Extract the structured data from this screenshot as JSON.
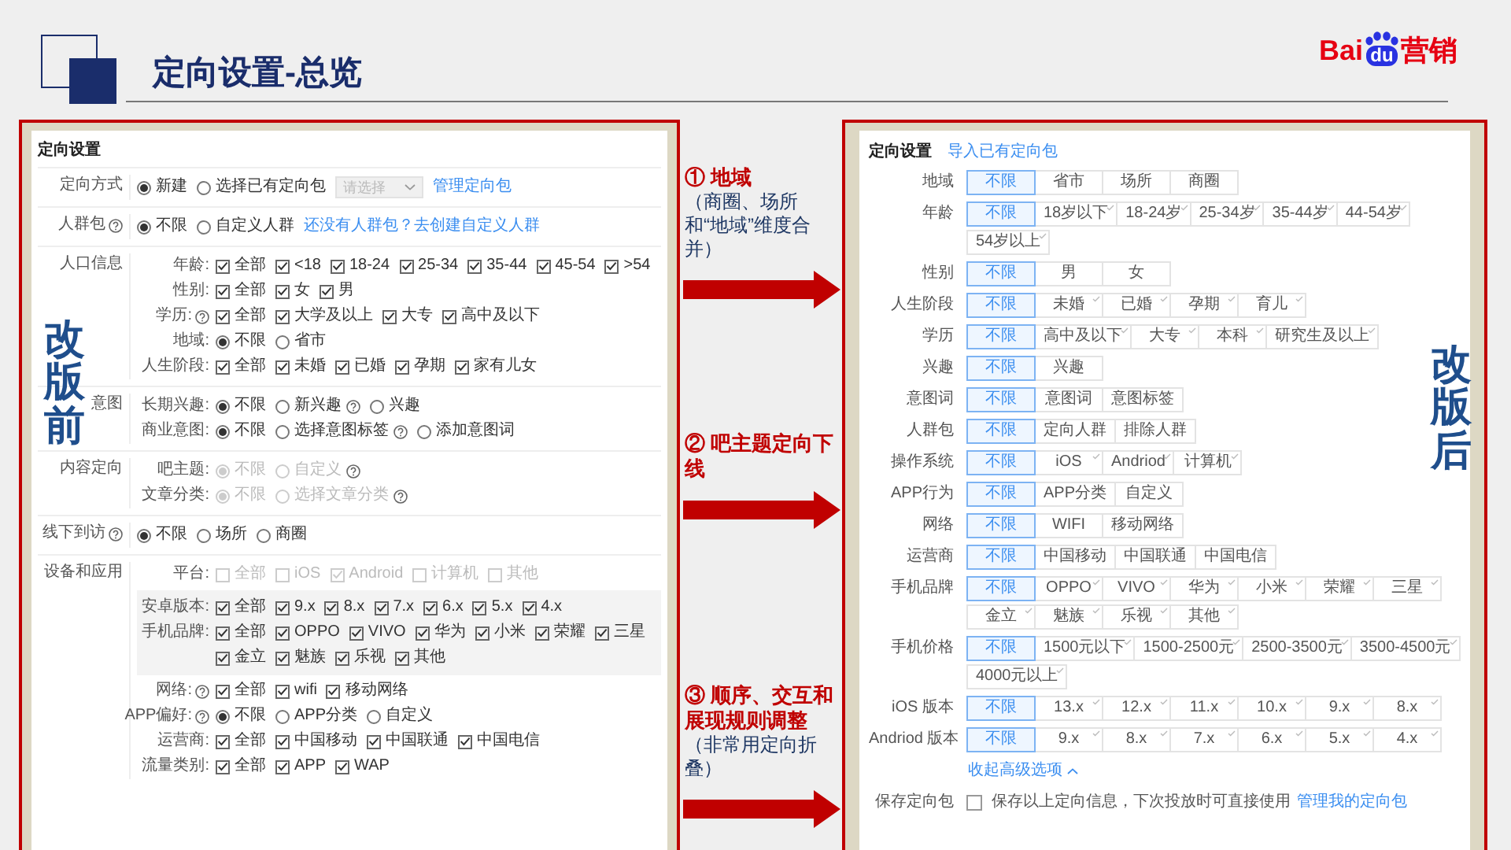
{
  "header": {
    "title": "定向设置-总览",
    "logo": {
      "left": "Bai",
      "mark": "du",
      "right": "营销"
    }
  },
  "before": {
    "badge": "改版前",
    "title": "定向设置",
    "sections": [
      {
        "label": "定向方式",
        "rows": [
          {
            "kind": "row",
            "options": [
              {
                "kind": "radio",
                "label": "新建",
                "checked": true
              },
              {
                "kind": "radio",
                "label": "选择已有定向包",
                "checked": false
              },
              {
                "kind": "select",
                "placeholder": "请选择"
              },
              {
                "kind": "link",
                "label": "管理定向包"
              }
            ]
          }
        ]
      },
      {
        "label": "人群包",
        "help": true,
        "rows": [
          {
            "kind": "row",
            "options": [
              {
                "kind": "radio",
                "label": "不限",
                "checked": true
              },
              {
                "kind": "radio",
                "label": "自定义人群",
                "checked": false
              },
              {
                "kind": "link",
                "label": "还没有人群包？去创建自定义人群"
              }
            ]
          }
        ]
      },
      {
        "label": "人口信息",
        "rows": [
          {
            "kind": "row",
            "label": "年龄:",
            "options": [
              {
                "kind": "checkbox",
                "label": "全部",
                "checked": true
              },
              {
                "kind": "checkbox",
                "label": "<18",
                "checked": true
              },
              {
                "kind": "checkbox",
                "label": "18-24",
                "checked": true
              },
              {
                "kind": "checkbox",
                "label": "25-34",
                "checked": true
              },
              {
                "kind": "checkbox",
                "label": "35-44",
                "checked": true
              },
              {
                "kind": "checkbox",
                "label": "45-54",
                "checked": true
              },
              {
                "kind": "checkbox",
                "label": ">54",
                "checked": true
              }
            ]
          },
          {
            "kind": "row",
            "label": "性别:",
            "options": [
              {
                "kind": "checkbox",
                "label": "全部",
                "checked": true
              },
              {
                "kind": "checkbox",
                "label": "女",
                "checked": true
              },
              {
                "kind": "checkbox",
                "label": "男",
                "checked": true
              }
            ]
          },
          {
            "kind": "row",
            "label": "学历:",
            "help": true,
            "options": [
              {
                "kind": "checkbox",
                "label": "全部",
                "checked": true
              },
              {
                "kind": "checkbox",
                "label": "大学及以上",
                "checked": true
              },
              {
                "kind": "checkbox",
                "label": "大专",
                "checked": true
              },
              {
                "kind": "checkbox",
                "label": "高中及以下",
                "checked": true
              }
            ]
          },
          {
            "kind": "row",
            "label": "地域:",
            "options": [
              {
                "kind": "radio",
                "label": "不限",
                "checked": true
              },
              {
                "kind": "radio",
                "label": "省市",
                "checked": false
              }
            ]
          },
          {
            "kind": "row",
            "label": "人生阶段:",
            "options": [
              {
                "kind": "checkbox",
                "label": "全部",
                "checked": true
              },
              {
                "kind": "checkbox",
                "label": "未婚",
                "checked": true
              },
              {
                "kind": "checkbox",
                "label": "已婚",
                "checked": true
              },
              {
                "kind": "checkbox",
                "label": "孕期",
                "checked": true
              },
              {
                "kind": "checkbox",
                "label": "家有儿女",
                "checked": true
              }
            ]
          }
        ]
      },
      {
        "label": "意图",
        "rows": [
          {
            "kind": "row",
            "label": "长期兴趣:",
            "options": [
              {
                "kind": "radio",
                "label": "不限",
                "checked": true
              },
              {
                "kind": "radio",
                "label": "新兴趣",
                "checked": false,
                "help": true
              },
              {
                "kind": "radio",
                "label": "兴趣",
                "checked": false
              }
            ]
          },
          {
            "kind": "row",
            "label": "商业意图:",
            "options": [
              {
                "kind": "radio",
                "label": "不限",
                "checked": true
              },
              {
                "kind": "radio",
                "label": "选择意图标签",
                "checked": false,
                "help": true
              },
              {
                "kind": "radio",
                "label": "添加意图词",
                "checked": false
              }
            ]
          }
        ]
      },
      {
        "label": "内容定向",
        "rows": [
          {
            "kind": "row",
            "label": "吧主题:",
            "options": [
              {
                "kind": "radio",
                "label": "不限",
                "checked": true,
                "disabled": true
              },
              {
                "kind": "radio",
                "label": "自定义",
                "checked": false,
                "disabled": true,
                "help": true
              }
            ]
          },
          {
            "kind": "row",
            "label": "文章分类:",
            "options": [
              {
                "kind": "radio",
                "label": "不限",
                "checked": true,
                "disabled": true
              },
              {
                "kind": "radio",
                "label": "选择文章分类",
                "checked": false,
                "disabled": true,
                "help": true
              }
            ]
          }
        ]
      },
      {
        "label": "线下到访",
        "help": true,
        "rows": [
          {
            "kind": "row",
            "options": [
              {
                "kind": "radio",
                "label": "不限",
                "checked": true
              },
              {
                "kind": "radio",
                "label": "场所",
                "checked": false
              },
              {
                "kind": "radio",
                "label": "商圈",
                "checked": false
              }
            ]
          }
        ]
      },
      {
        "label": "设备和应用",
        "rows": [
          {
            "kind": "row",
            "label": "平台:",
            "options": [
              {
                "kind": "checkbox",
                "label": "全部",
                "checked": false,
                "disabled": true
              },
              {
                "kind": "checkbox",
                "label": "iOS",
                "checked": false,
                "disabled": true
              },
              {
                "kind": "checkbox",
                "label": "Android",
                "checked": true,
                "disabled": true
              },
              {
                "kind": "checkbox",
                "label": "计算机",
                "checked": false,
                "disabled": true
              },
              {
                "kind": "checkbox",
                "label": "其他",
                "checked": false,
                "disabled": true
              }
            ]
          },
          {
            "kind": "group",
            "rows": [
              {
                "kind": "row",
                "label": "安卓版本:",
                "options": [
                  {
                    "kind": "checkbox",
                    "label": "全部",
                    "checked": true
                  },
                  {
                    "kind": "checkbox",
                    "label": "9.x",
                    "checked": true
                  },
                  {
                    "kind": "checkbox",
                    "label": "8.x",
                    "checked": true
                  },
                  {
                    "kind": "checkbox",
                    "label": "7.x",
                    "checked": true
                  },
                  {
                    "kind": "checkbox",
                    "label": "6.x",
                    "checked": true
                  },
                  {
                    "kind": "checkbox",
                    "label": "5.x",
                    "checked": true
                  },
                  {
                    "kind": "checkbox",
                    "label": "4.x",
                    "checked": true
                  }
                ]
              },
              {
                "kind": "row",
                "label": "手机品牌:",
                "options": [
                  {
                    "kind": "checkbox",
                    "label": "全部",
                    "checked": true
                  },
                  {
                    "kind": "checkbox",
                    "label": "OPPO",
                    "checked": true
                  },
                  {
                    "kind": "checkbox",
                    "label": "VIVO",
                    "checked": true
                  },
                  {
                    "kind": "checkbox",
                    "label": "华为",
                    "checked": true
                  },
                  {
                    "kind": "checkbox",
                    "label": "小米",
                    "checked": true
                  },
                  {
                    "kind": "checkbox",
                    "label": "荣耀",
                    "checked": true
                  },
                  {
                    "kind": "checkbox",
                    "label": "三星",
                    "checked": true
                  },
                  {
                    "kind": "checkbox",
                    "label": "金立",
                    "checked": true
                  },
                  {
                    "kind": "checkbox",
                    "label": "魅族",
                    "checked": true
                  },
                  {
                    "kind": "checkbox",
                    "label": "乐视",
                    "checked": true
                  },
                  {
                    "kind": "checkbox",
                    "label": "其他",
                    "checked": true
                  }
                ]
              }
            ]
          },
          {
            "kind": "row",
            "label": "网络:",
            "help": true,
            "options": [
              {
                "kind": "checkbox",
                "label": "全部",
                "checked": true
              },
              {
                "kind": "checkbox",
                "label": "wifi",
                "checked": true
              },
              {
                "kind": "checkbox",
                "label": "移动网络",
                "checked": true
              }
            ]
          },
          {
            "kind": "row",
            "label": "APP偏好:",
            "help": true,
            "options": [
              {
                "kind": "radio",
                "label": "不限",
                "checked": true
              },
              {
                "kind": "radio",
                "label": "APP分类",
                "checked": false
              },
              {
                "kind": "radio",
                "label": "自定义",
                "checked": false
              }
            ]
          },
          {
            "kind": "row",
            "label": "运营商:",
            "options": [
              {
                "kind": "checkbox",
                "label": "全部",
                "checked": true
              },
              {
                "kind": "checkbox",
                "label": "中国移动",
                "checked": true
              },
              {
                "kind": "checkbox",
                "label": "中国联通",
                "checked": true
              },
              {
                "kind": "checkbox",
                "label": "中国电信",
                "checked": true
              }
            ]
          },
          {
            "kind": "row",
            "label": "流量类别:",
            "options": [
              {
                "kind": "checkbox",
                "label": "全部",
                "checked": true
              },
              {
                "kind": "checkbox",
                "label": "APP",
                "checked": true
              },
              {
                "kind": "checkbox",
                "label": "WAP",
                "checked": true
              }
            ]
          }
        ]
      }
    ]
  },
  "notes": [
    {
      "title": "① 地域",
      "note": "（商圈、场所和“地域”维度合并）"
    },
    {
      "title": "② 吧主题定向下线"
    },
    {
      "title": "③ 顺序、交互和展现规则调整",
      "note": "（非常用定向折叠）"
    }
  ],
  "after": {
    "badge": "改版后",
    "title": "定向设置",
    "import_link": "导入已有定向包",
    "rows": [
      {
        "label": "地域",
        "multi": false,
        "options": [
          {
            "label": "不限",
            "selected": true
          },
          {
            "label": "省市",
            "selected": false
          },
          {
            "label": "场所",
            "selected": false
          },
          {
            "label": "商圈",
            "selected": false
          }
        ]
      },
      {
        "label": "年龄",
        "multi": true,
        "options": [
          {
            "label": "不限",
            "selected": true
          },
          {
            "label": "18岁以下",
            "selected": false
          },
          {
            "label": "18-24岁",
            "selected": false
          },
          {
            "label": "25-34岁",
            "selected": false
          },
          {
            "label": "35-44岁",
            "selected": false
          },
          {
            "label": "44-54岁",
            "selected": false
          },
          {
            "label": "54岁以上",
            "selected": false
          }
        ]
      },
      {
        "label": "性别",
        "multi": false,
        "options": [
          {
            "label": "不限",
            "selected": true
          },
          {
            "label": "男",
            "selected": false
          },
          {
            "label": "女",
            "selected": false
          }
        ]
      },
      {
        "label": "人生阶段",
        "multi": true,
        "options": [
          {
            "label": "不限",
            "selected": true
          },
          {
            "label": "未婚",
            "selected": false
          },
          {
            "label": "已婚",
            "selected": false
          },
          {
            "label": "孕期",
            "selected": false
          },
          {
            "label": "育儿",
            "selected": false
          }
        ]
      },
      {
        "label": "学历",
        "multi": true,
        "options": [
          {
            "label": "不限",
            "selected": true
          },
          {
            "label": "高中及以下",
            "selected": false
          },
          {
            "label": "大专",
            "selected": false
          },
          {
            "label": "本科",
            "selected": false
          },
          {
            "label": "研究生及以上",
            "selected": false
          }
        ]
      },
      {
        "label": "兴趣",
        "multi": false,
        "options": [
          {
            "label": "不限",
            "selected": true
          },
          {
            "label": "兴趣",
            "selected": false
          }
        ]
      },
      {
        "label": "意图词",
        "multi": false,
        "options": [
          {
            "label": "不限",
            "selected": true
          },
          {
            "label": "意图词",
            "selected": false
          },
          {
            "label": "意图标签",
            "selected": false
          }
        ]
      },
      {
        "label": "人群包",
        "multi": false,
        "options": [
          {
            "label": "不限",
            "selected": true
          },
          {
            "label": "定向人群",
            "selected": false
          },
          {
            "label": "排除人群",
            "selected": false
          }
        ]
      },
      {
        "label": "操作系统",
        "multi": true,
        "options": [
          {
            "label": "不限",
            "selected": true
          },
          {
            "label": "iOS",
            "selected": false
          },
          {
            "label": "Andriod",
            "selected": false
          },
          {
            "label": "计算机",
            "selected": false
          }
        ]
      },
      {
        "label": "APP行为",
        "multi": false,
        "options": [
          {
            "label": "不限",
            "selected": true
          },
          {
            "label": "APP分类",
            "selected": false
          },
          {
            "label": "自定义",
            "selected": false
          }
        ]
      },
      {
        "label": "网络",
        "multi": false,
        "options": [
          {
            "label": "不限",
            "selected": true
          },
          {
            "label": "WIFI",
            "selected": false
          },
          {
            "label": "移动网络",
            "selected": false
          }
        ]
      },
      {
        "label": "运营商",
        "multi": false,
        "options": [
          {
            "label": "不限",
            "selected": true
          },
          {
            "label": "中国移动",
            "selected": false
          },
          {
            "label": "中国联通",
            "selected": false
          },
          {
            "label": "中国电信",
            "selected": false
          }
        ]
      },
      {
        "label": "手机品牌",
        "multi": true,
        "options": [
          {
            "label": "不限",
            "selected": true
          },
          {
            "label": "OPPO",
            "selected": false
          },
          {
            "label": "VIVO",
            "selected": false
          },
          {
            "label": "华为",
            "selected": false
          },
          {
            "label": "小米",
            "selected": false
          },
          {
            "label": "荣耀",
            "selected": false
          },
          {
            "label": "三星",
            "selected": false
          },
          {
            "label": "金立",
            "selected": false
          },
          {
            "label": "魅族",
            "selected": false
          },
          {
            "label": "乐视",
            "selected": false
          },
          {
            "label": "其他",
            "selected": false
          }
        ]
      },
      {
        "label": "手机价格",
        "multi": true,
        "options": [
          {
            "label": "不限",
            "selected": true
          },
          {
            "label": "1500元以下",
            "selected": false
          },
          {
            "label": "1500-2500元",
            "selected": false
          },
          {
            "label": "2500-3500元",
            "selected": false
          },
          {
            "label": "3500-4500元",
            "selected": false
          },
          {
            "label": "4000元以上",
            "selected": false
          }
        ]
      },
      {
        "label": "iOS 版本",
        "multi": true,
        "options": [
          {
            "label": "不限",
            "selected": true
          },
          {
            "label": "13.x",
            "selected": false
          },
          {
            "label": "12.x",
            "selected": false
          },
          {
            "label": "11.x",
            "selected": false
          },
          {
            "label": "10.x",
            "selected": false
          },
          {
            "label": "9.x",
            "selected": false
          },
          {
            "label": "8.x",
            "selected": false
          }
        ]
      },
      {
        "label": "Andriod 版本",
        "multi": true,
        "options": [
          {
            "label": "不限",
            "selected": true
          },
          {
            "label": "9.x",
            "selected": false
          },
          {
            "label": "8.x",
            "selected": false
          },
          {
            "label": "7.x",
            "selected": false
          },
          {
            "label": "6.x",
            "selected": false
          },
          {
            "label": "5.x",
            "selected": false
          },
          {
            "label": "4.x",
            "selected": false
          }
        ]
      }
    ],
    "collapse_link": "收起高级选项",
    "save": {
      "label": "保存定向包",
      "checked": false,
      "text": "保存以上定向信息，下次投放时可直接使用",
      "link": "管理我的定向包"
    }
  }
}
